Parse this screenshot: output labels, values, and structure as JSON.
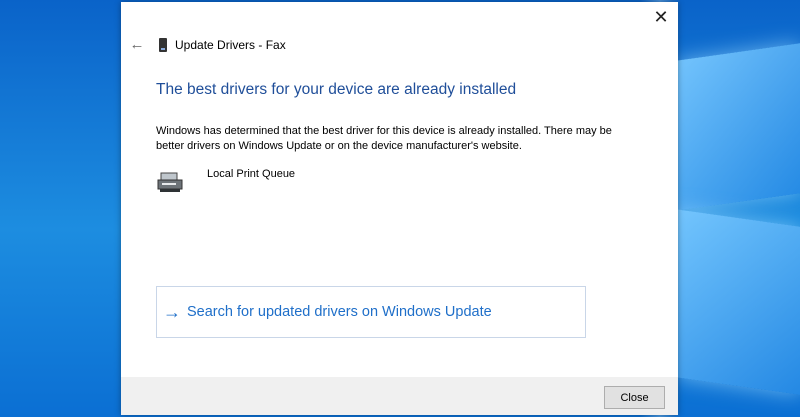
{
  "window": {
    "title": "Update Drivers - Fax",
    "close_glyph": "✕",
    "back_glyph": "←"
  },
  "content": {
    "headline": "The best drivers for your device are already installed",
    "description": "Windows has determined that the best driver for this device is already installed. There may be better drivers on Windows Update or on the device manufacturer's website.",
    "device_name": "Local Print Queue"
  },
  "link": {
    "arrow_glyph": "→",
    "label": "Search for updated drivers on Windows Update"
  },
  "footer": {
    "close_label": "Close"
  },
  "colors": {
    "accent": "#1f6fc9",
    "headline": "#1f4e99",
    "desktop": "#0a63c9"
  }
}
